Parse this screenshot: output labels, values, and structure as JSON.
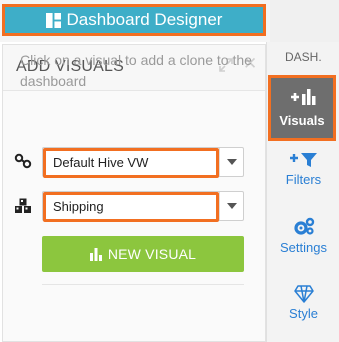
{
  "header": {
    "title": "Dashboard Designer"
  },
  "panel": {
    "title": "ADD VISUALS",
    "hint": "Click on a visual to add a clone to the dashboard",
    "dataset_select": {
      "value": "Default Hive VW"
    },
    "table_select": {
      "value": "Shipping"
    },
    "new_visual_label": "NEW VISUAL"
  },
  "sidebar": {
    "section_label": "DASH.",
    "items": [
      {
        "label": "Visuals",
        "icon": "add-chart-icon",
        "active": true
      },
      {
        "label": "Filters",
        "icon": "add-filter-icon"
      },
      {
        "label": "Settings",
        "icon": "gears-icon"
      },
      {
        "label": "Style",
        "icon": "diamond-icon"
      }
    ]
  },
  "colors": {
    "accent_teal": "#3eaec8",
    "highlight_orange": "#f26f21",
    "action_green": "#8cc63e",
    "link_blue": "#2a7fd4",
    "active_gray": "#6e6e6e"
  }
}
